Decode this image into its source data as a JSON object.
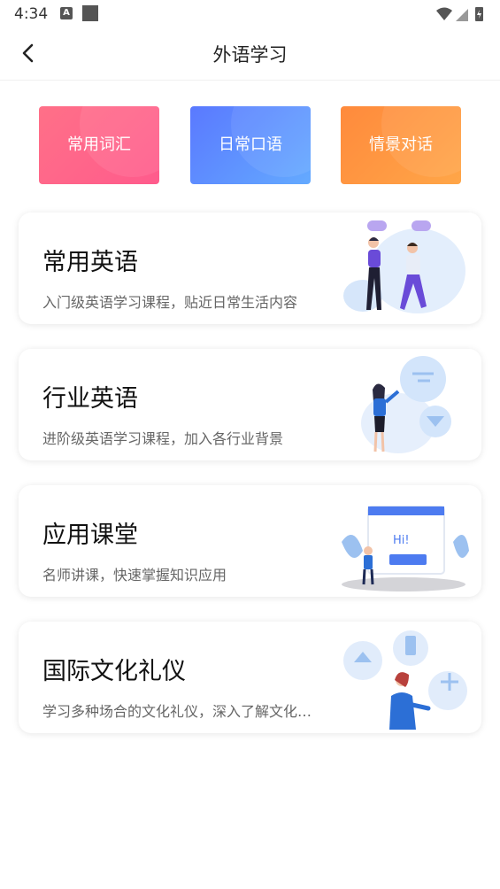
{
  "status_bar": {
    "time": "4:34",
    "notif_letter": "A"
  },
  "header": {
    "title": "外语学习"
  },
  "tiles": [
    {
      "label": "常用词汇",
      "color_from": "#ff6f85",
      "color_to": "#ff5a8a"
    },
    {
      "label": "日常口语",
      "color_from": "#5b7cff",
      "color_to": "#62a6ff"
    },
    {
      "label": "情景对话",
      "color_from": "#ff8a3d",
      "color_to": "#ffa347"
    }
  ],
  "courses": [
    {
      "title": "常用英语",
      "desc": "入门级英语学习课程，贴近日常生活内容"
    },
    {
      "title": "行业英语",
      "desc": "进阶级英语学习课程，加入各行业背景"
    },
    {
      "title": "应用课堂",
      "desc": "名师讲课，快速掌握知识应用"
    },
    {
      "title": "国际文化礼仪",
      "desc": "学习多种场合的文化礼仪，深入了解文化差异"
    }
  ],
  "illustrations": {
    "classroom_bubble": "Hi!"
  },
  "colors": {
    "illus_blue": "#d7e8fb",
    "illus_dark": "#2b3b8f"
  }
}
